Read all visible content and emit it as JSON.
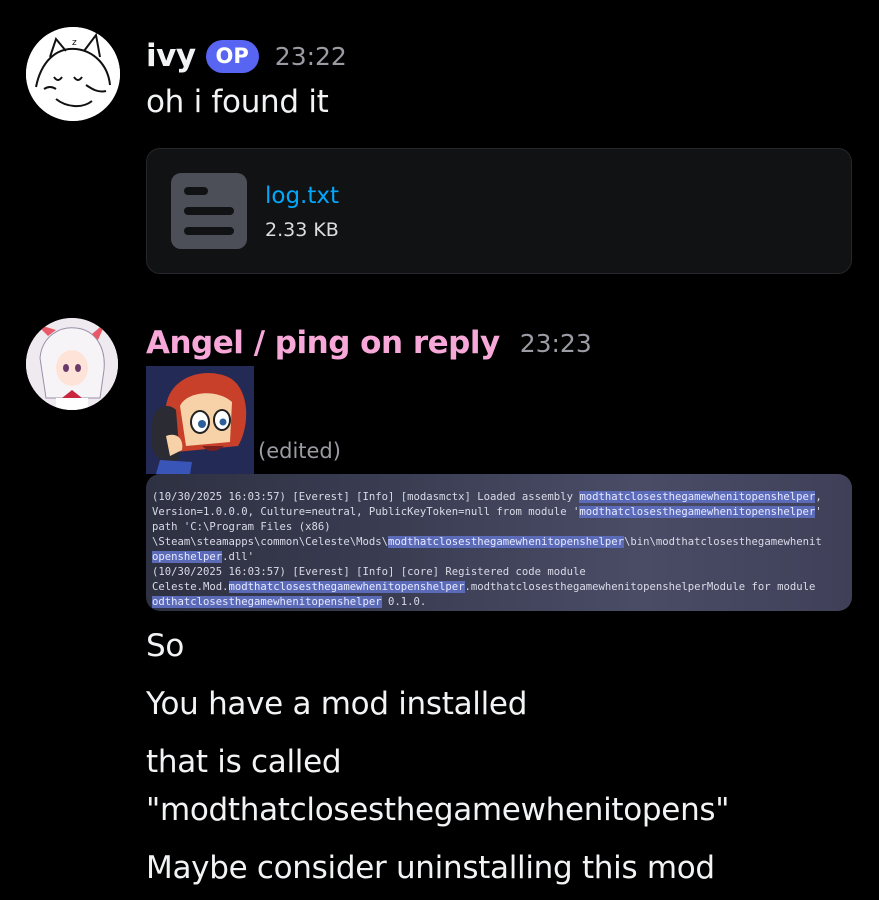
{
  "messages": [
    {
      "author": "ivy",
      "badge": "OP",
      "time": "23:22",
      "author_color": "#f2f3f5",
      "text": "oh i found it",
      "attachment": {
        "icon": "text-file-icon",
        "name": "log.txt",
        "size": "2.33 KB"
      }
    },
    {
      "author": "Angel / ping on reply",
      "time": "23:23",
      "author_color": "#f7a8d8",
      "sticker": "phone-call-character-sticker",
      "edited": "(edited)",
      "log_lines": [
        [
          "(10/30/2025 16:03:57) [Everest] [Info] [modasmctx] Loaded assembly ",
          "modthatclosesthegamewhenitopenshelper",
          ","
        ],
        [
          "Version=1.0.0.0, Culture=neutral, PublicKeyToken=null from module '",
          "modthatclosesthegamewhenitopenshelper",
          "'"
        ],
        [
          "path 'C:\\Program Files (x86)",
          "",
          ""
        ],
        [
          "\\Steam\\steamapps\\common\\Celeste\\Mods\\",
          "modthatclosesthegamewhenitopenshelper",
          "\\bin\\modthatclosesthegamewhenit"
        ],
        [
          "",
          "openshelper",
          ".dll'"
        ],
        [
          "(10/30/2025 16:03:57) [Everest] [Info] [core] Registered code module",
          "",
          ""
        ],
        [
          "Celeste.Mod.",
          "modthatclosesthegamewhenitopenshelper",
          ".modthatclosesthegamewhenitopenshelperModule for module"
        ],
        [
          "",
          "odthatclosesthegamewhenitopenshelper",
          " 0.1.0."
        ]
      ],
      "lines": [
        "So",
        "You have a mod installed",
        "that is called",
        "\"modthatclosesthegamewhenitopens\"",
        "Maybe consider uninstalling this mod"
      ]
    }
  ]
}
